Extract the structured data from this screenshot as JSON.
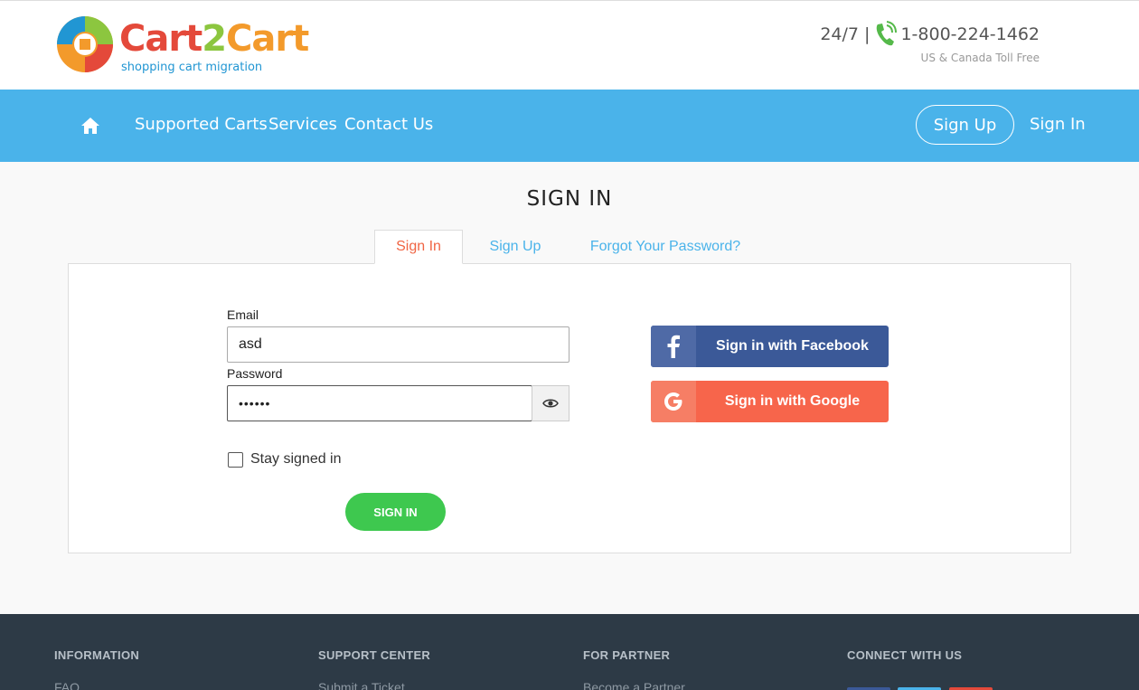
{
  "header": {
    "logo": {
      "part1": "Cart",
      "part2": "2",
      "part3": "Cart",
      "tagline": "shopping cart migration"
    },
    "phone": {
      "hours": "24/7 |",
      "number": "1-800-224-1462",
      "note": "US & Canada Toll Free"
    }
  },
  "nav": {
    "items": [
      "Supported Carts",
      "Services",
      "Contact Us"
    ],
    "signup": "Sign Up",
    "signin": "Sign In"
  },
  "main": {
    "title": "SIGN IN",
    "tabs": [
      "Sign In",
      "Sign Up",
      "Forgot Your Password?"
    ],
    "active_tab": "Sign In",
    "form": {
      "email_label": "Email",
      "email_value": "asd",
      "password_label": "Password",
      "password_value": "••••••",
      "stay_label": "Stay signed in",
      "stay_checked": false,
      "submit": "SIGN IN"
    },
    "social": {
      "facebook": "Sign in with Facebook",
      "google": "Sign in with Google"
    }
  },
  "footer": {
    "columns": [
      "INFORMATION",
      "SUPPORT CENTER",
      "FOR PARTNER",
      "CONNECT WITH US"
    ],
    "links": [
      "FAQ",
      "Submit a Ticket",
      "Become a Partner"
    ]
  },
  "colors": {
    "nav_bg": "#4ab3ea",
    "active_tab": "#f06544",
    "submit_green": "#3ec84f",
    "facebook": "#3b5998",
    "google": "#f7654b",
    "footer_bg": "#2d3a46"
  }
}
